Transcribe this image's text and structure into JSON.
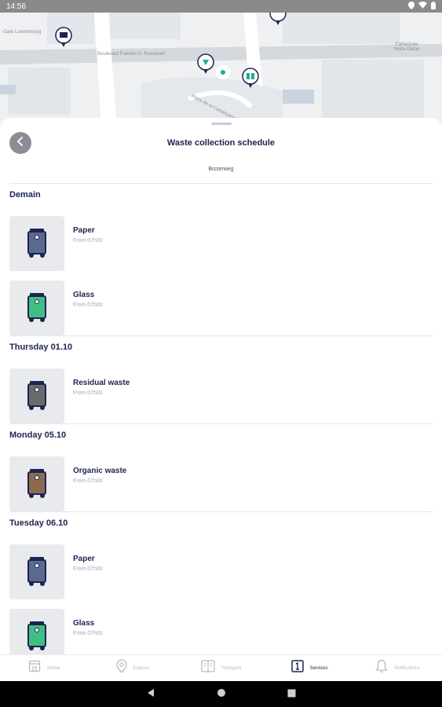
{
  "status": {
    "time": "14:56"
  },
  "map": {
    "labels": [
      "Gare Luxembourg",
      "Boulevard Franklin D. Roosevelt",
      "Place de la Constitution",
      "Cathédrale Notre-Dame"
    ]
  },
  "header": {
    "title": "Waste collection schedule",
    "street": "Bisserweg"
  },
  "sections": [
    {
      "title": "Demain",
      "items": [
        {
          "name": "Paper",
          "time": "From 07h00",
          "color": "#5a6a8c"
        },
        {
          "name": "Glass",
          "time": "From 07h00",
          "color": "#3fbf84"
        }
      ]
    },
    {
      "title": "Thursday 01.10",
      "items": [
        {
          "name": "Residual waste",
          "time": "From 07h00",
          "color": "#6a6a6a"
        }
      ]
    },
    {
      "title": "Monday 05.10",
      "items": [
        {
          "name": "Organic waste",
          "time": "From 07h00",
          "color": "#8b6a4e"
        }
      ]
    },
    {
      "title": "Tuesday 06.10",
      "items": [
        {
          "name": "Paper",
          "time": "From 07h00",
          "color": "#5a6a8c"
        },
        {
          "name": "Glass",
          "time": "From 07h00",
          "color": "#3fbf84"
        }
      ]
    }
  ],
  "tabs": [
    {
      "label": "Home",
      "icon": "home-icon",
      "active": false
    },
    {
      "label": "Explore",
      "icon": "location-pin-icon",
      "active": false
    },
    {
      "label": "Transport",
      "icon": "transport-icon",
      "active": false
    },
    {
      "label": "Services",
      "icon": "services-icon",
      "active": true
    },
    {
      "label": "Notifications",
      "icon": "bell-icon",
      "active": false
    }
  ],
  "colors": {
    "primary": "#1c2452",
    "map_pin": "#1c2452",
    "location_dot": "#17b28a"
  }
}
